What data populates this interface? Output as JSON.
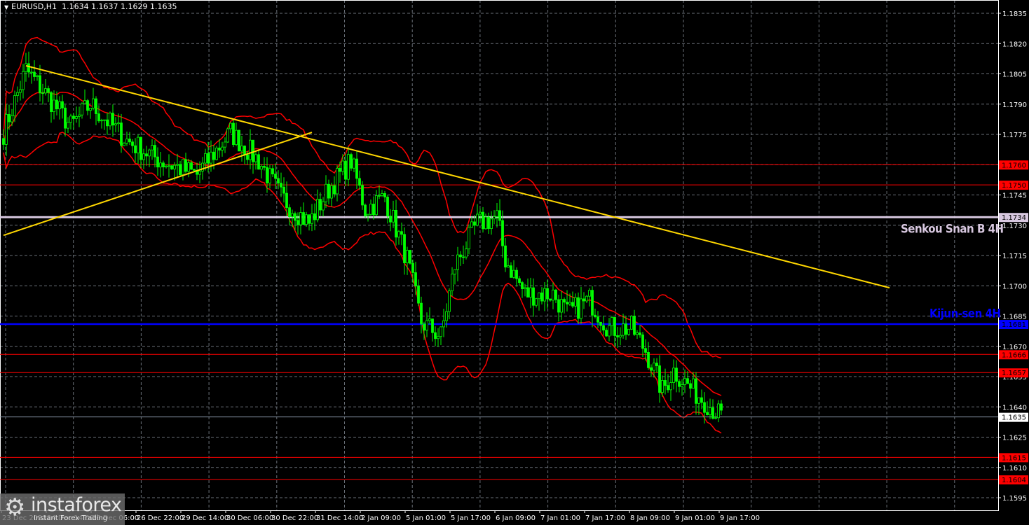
{
  "header": {
    "symbol": "EURUSD,H1",
    "ohlc": "1.1634 1.1637 1.1629 1.1635"
  },
  "logo": {
    "name": "instaforex",
    "tagline": "Instant Forex Trading"
  },
  "labels": {
    "senkou": "Senkou Snan B 4H",
    "kijun": "Kijun-sen 4H"
  },
  "colors": {
    "candle": "#00ff00",
    "band": "#ff0000",
    "trend": "#ffd700",
    "kijun": "#0000ff",
    "senkou": "#d8c8e0",
    "level": "#ff0000"
  },
  "chart_data": {
    "type": "candlestick",
    "symbol": "EURUSD",
    "timeframe": "H1",
    "ylim": [
      1.1588,
      1.1841
    ],
    "price_ticks": [
      "1.1835",
      "1.1820",
      "1.1805",
      "1.1790",
      "1.1775",
      "1.1760",
      "1.1745",
      "1.1730",
      "1.1715",
      "1.1700",
      "1.1685",
      "1.1670",
      "1.1655",
      "1.1640",
      "1.1625",
      "1.1610",
      "1.1595"
    ],
    "time_ticks": [
      "23 Dec 2025",
      "24 Dec 14:00",
      "26 Dec 06:00",
      "26 Dec 22:00",
      "29 Dec 14:00",
      "30 Dec 06:00",
      "30 Dec 22:00",
      "31 Dec 14:00",
      "2 Jan 09:00",
      "5 Jan 01:00",
      "5 Jan 17:00",
      "6 Jan 09:00",
      "7 Jan 01:00",
      "7 Jan 17:00",
      "8 Jan 09:00",
      "9 Jan 01:00",
      "9 Jan 17:00"
    ],
    "bars_per_time_tick": 16,
    "close_keypoints": [
      [
        0,
        1.1776
      ],
      [
        8,
        1.1807
      ],
      [
        14,
        1.1797
      ],
      [
        24,
        1.1779
      ],
      [
        31,
        1.179
      ],
      [
        44,
        1.1772
      ],
      [
        56,
        1.1762
      ],
      [
        69,
        1.1755
      ],
      [
        81,
        1.1776
      ],
      [
        91,
        1.1762
      ],
      [
        99,
        1.1744
      ],
      [
        109,
        1.1731
      ],
      [
        116,
        1.1748
      ],
      [
        124,
        1.1762
      ],
      [
        129,
        1.1738
      ],
      [
        136,
        1.1744
      ],
      [
        144,
        1.1713
      ],
      [
        149,
        1.1682
      ],
      [
        156,
        1.1675
      ],
      [
        161,
        1.171
      ],
      [
        169,
        1.1731
      ],
      [
        176,
        1.1734
      ],
      [
        179,
        1.1713
      ],
      [
        186,
        1.1696
      ],
      [
        196,
        1.1696
      ],
      [
        201,
        1.1686
      ],
      [
        209,
        1.1693
      ],
      [
        216,
        1.1679
      ],
      [
        224,
        1.1679
      ],
      [
        229,
        1.1668
      ],
      [
        235,
        1.1648
      ],
      [
        239,
        1.1658
      ],
      [
        246,
        1.1648
      ],
      [
        251,
        1.1642
      ],
      [
        256,
        1.1635
      ]
    ],
    "levels": [
      {
        "price": "1.1760",
        "kind": "resistance"
      },
      {
        "price": "1.1750",
        "kind": "resistance"
      },
      {
        "price": "1.1734",
        "kind": "senkou"
      },
      {
        "price": "1.1681",
        "kind": "kijun"
      },
      {
        "price": "1.1666",
        "kind": "support"
      },
      {
        "price": "1.1657",
        "kind": "support"
      },
      {
        "price": "1.1635",
        "kind": "current"
      },
      {
        "price": "1.1615",
        "kind": "support"
      },
      {
        "price": "1.1604",
        "kind": "support"
      }
    ],
    "trendlines": [
      {
        "name": "downtrend",
        "from": [
          8,
          1.1809
        ],
        "to": [
          316,
          1.1699
        ]
      },
      {
        "name": "uptrend",
        "from": [
          0,
          1.1725
        ],
        "to": [
          110,
          1.1776
        ]
      }
    ]
  }
}
